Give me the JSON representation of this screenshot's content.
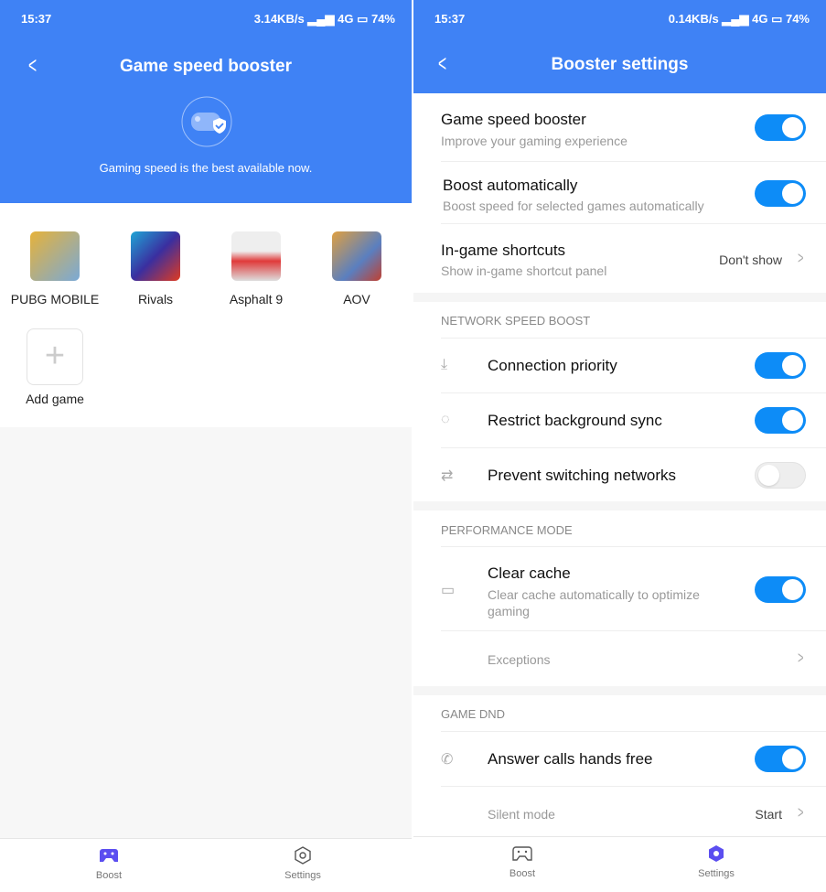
{
  "left": {
    "status": {
      "time": "15:37",
      "speed": "3.14KB/s",
      "network": "4G",
      "battery": "74%"
    },
    "header": {
      "title": "Game speed booster",
      "subtitle": "Gaming speed is the best available now."
    },
    "games": [
      {
        "name": "PUBG MOBILE",
        "color": "#c9a640"
      },
      {
        "name": "Rivals",
        "color": "#2b3fa8"
      },
      {
        "name": "Asphalt 9",
        "color": "#e03a3a"
      },
      {
        "name": "AOV",
        "color": "#d07a35"
      }
    ],
    "add_game": "Add game",
    "nav": [
      {
        "label": "Boost",
        "icon": "gamepad-icon",
        "active": true
      },
      {
        "label": "Settings",
        "icon": "gear-icon",
        "active": false
      }
    ]
  },
  "right": {
    "status": {
      "time": "15:37",
      "speed": "0.14KB/s",
      "network": "4G",
      "battery": "74%"
    },
    "header": {
      "title": "Booster settings"
    },
    "general": [
      {
        "title": "Game speed booster",
        "subtitle": "Improve your gaming experience",
        "on": true
      },
      {
        "title": "Boost automatically",
        "subtitle": "Boost speed for selected games automatically",
        "on": true
      },
      {
        "title": "In-game shortcuts",
        "subtitle": "Show in-game shortcut panel",
        "value": "Don't show"
      }
    ],
    "network": {
      "header": "NETWORK SPEED BOOST",
      "items": [
        {
          "title": "Connection priority",
          "icon": "download-icon",
          "on": true
        },
        {
          "title": "Restrict background sync",
          "icon": "sync-icon",
          "on": true
        },
        {
          "title": "Prevent switching networks",
          "icon": "swap-icon",
          "on": false
        }
      ]
    },
    "performance": {
      "header": "PERFORMANCE MODE",
      "clear_cache": {
        "title": "Clear cache",
        "subtitle": "Clear cache automatically to optimize gaming",
        "on": true
      },
      "exceptions": "Exceptions"
    },
    "dnd": {
      "header": "GAME DND",
      "answer_calls": {
        "title": "Answer calls hands free",
        "on": true
      },
      "silent": {
        "title": "Silent mode",
        "value": "Start"
      }
    },
    "nav": [
      {
        "label": "Boost",
        "icon": "gamepad-icon",
        "active": false
      },
      {
        "label": "Settings",
        "icon": "gear-icon",
        "active": true
      }
    ]
  },
  "colors": {
    "header": "#3f82f5",
    "toggle_on": "#0d8cf7",
    "nav_active": "#5b4ef0"
  }
}
